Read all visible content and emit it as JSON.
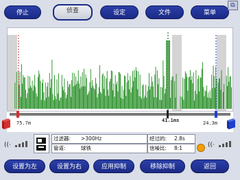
{
  "toolbar": {
    "stop_label": "停止",
    "listen_label": "侦查",
    "settings_label": "设定",
    "file_label": "文件",
    "menu_label": "菜单"
  },
  "chart": {
    "time_marker_label": "41.1ms",
    "left_distance": "75.7m",
    "right_distance": "24.3m"
  },
  "info": {
    "filter_label": "过滤器:",
    "filter_value": ">300Hz",
    "elapsed_label": "经过的:",
    "elapsed_value": "2.8s",
    "pipe_label": "管道:",
    "pipe_value": "球铁",
    "snr_label": "信噪比:",
    "snr_value": "8:1"
  },
  "bottom": {
    "set_left_label": "设置为左",
    "set_right_label": "设置为右",
    "apply_suppress_label": "应用抑制",
    "remove_suppress_label": "移除抑制",
    "back_label": "返回"
  },
  "colors": {
    "bar_green": "#1f8a1f",
    "button_blue": "#1b2a85",
    "left_marker_red": "#d23030",
    "right_marker_blue": "#2040d0",
    "status_orange": "#f0a000"
  },
  "icons": {
    "corner": "restore-icon",
    "left_sensor": "red-book-sensor-icon",
    "right_sensor": "blue-book-sensor-icon",
    "left_signal": "signal-strength-icon",
    "right_signal": "signal-strength-icon",
    "mute": "speaker-icon",
    "status_dot": "status-dot-icon"
  },
  "correlation": {
    "time_marker_ms": 41.1,
    "left_marker_fraction": 0.05,
    "center_marker_fraction": 0.76,
    "right_marker_fraction": 0.925
  }
}
